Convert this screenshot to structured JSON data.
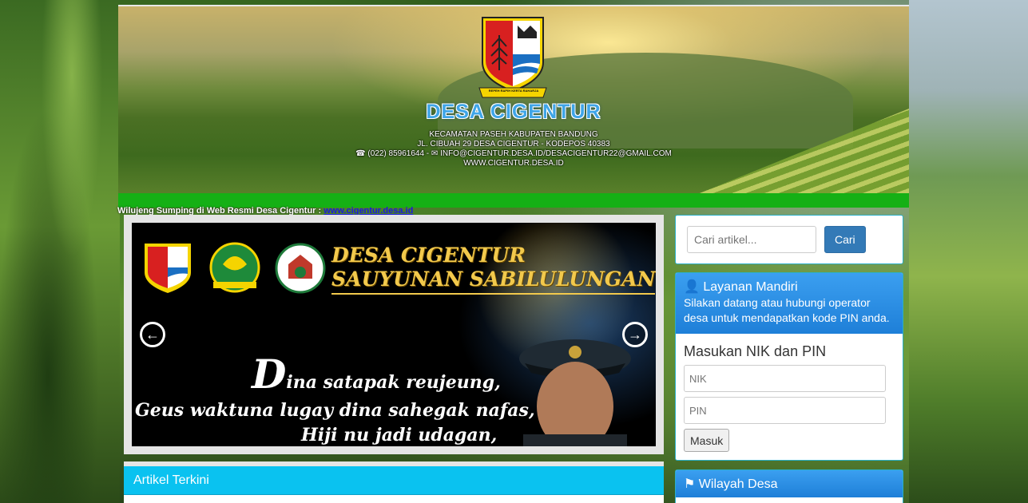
{
  "header": {
    "title": "DESA CIGENTUR",
    "logo_motto": "REPEH RAPIH KERTA RAHARJA",
    "address_line1": "KECAMATAN PASEH KABUPATEN BANDUNG",
    "address_line2": "JL. CIBUAH 29 DESA CIGENTUR - KODEPOS 40383",
    "phone": "(022) 85961644 -",
    "email": "INFO@CIGENTUR.DESA.ID/DESACIGENTUR22@GMAIL.COM",
    "website": "WWW.CIGENTUR.DESA.ID"
  },
  "marquee": {
    "text": "Wilujeng Sumping di Web Resmi Desa Cigentur :",
    "link": "www.cigentur.desa.id"
  },
  "slider": {
    "title_line1": "DESA CIGENTUR",
    "title_line2": "SAUYUNAN SABILULUNGAN",
    "quote_initial": "D",
    "quote_line1_rest": "ina satapak reujeung,",
    "quote_line2": "Geus waktuna lugay dina sahegak nafas,",
    "quote_line3": "Hiji nu jadi udagan,"
  },
  "articles": {
    "heading": "Artikel Terkini"
  },
  "search": {
    "placeholder": "Cari artikel...",
    "button": "Cari"
  },
  "layanan": {
    "title": "Layanan Mandiri",
    "description": "Silakan datang atau hubungi operator desa untuk mendapatkan kode PIN anda.",
    "form_title": "Masukan NIK dan PIN",
    "nik_placeholder": "NIK",
    "pin_placeholder": "PIN",
    "submit": "Masuk"
  },
  "wilayah": {
    "title": "Wilayah Desa"
  },
  "colors": {
    "green_bar": "#15b015",
    "article_header": "#0ac2f0",
    "panel_header": "#1e7fd8",
    "search_button": "#337ab7"
  }
}
